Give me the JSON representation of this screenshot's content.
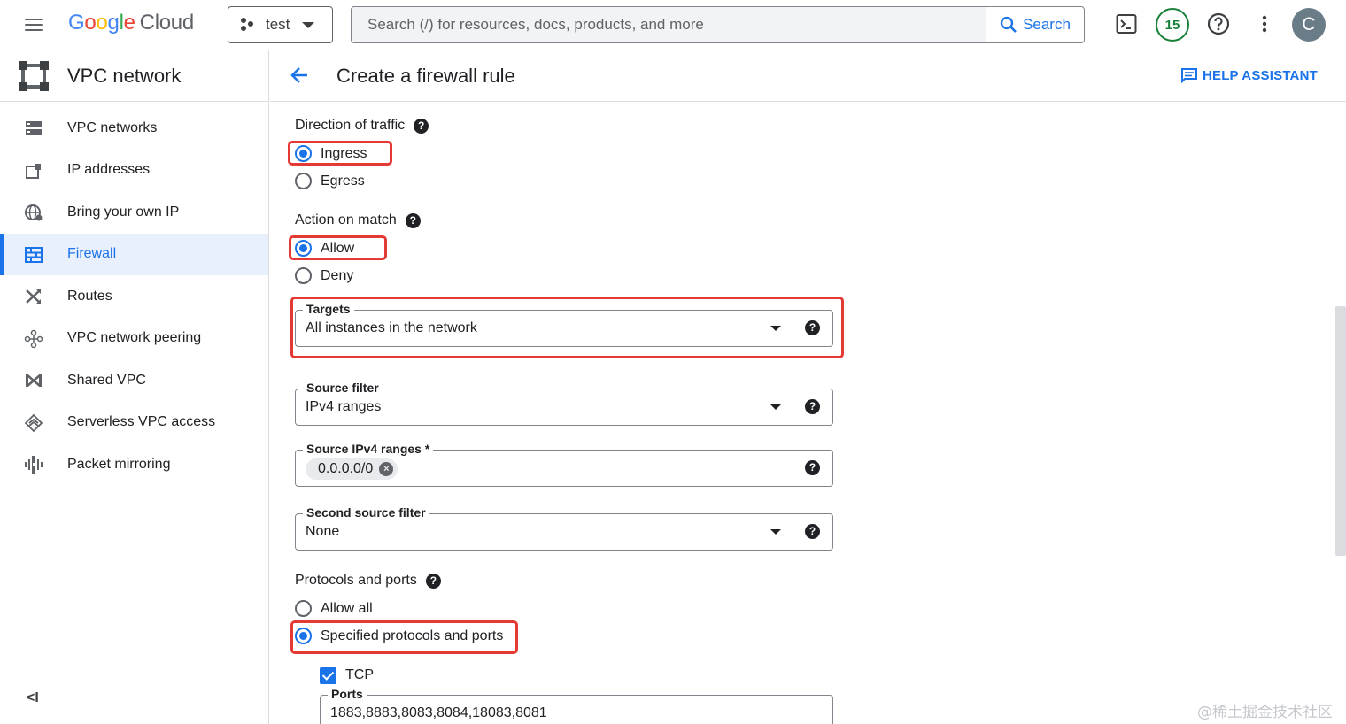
{
  "topbar": {
    "logo_google": [
      "G",
      "o",
      "o",
      "g",
      "l",
      "e"
    ],
    "logo_cloud": "Cloud",
    "project": "test",
    "search_placeholder": "Search (/) for resources, docs, products, and more",
    "search_button": "Search",
    "notifications_count": "15",
    "avatar_letter": "C"
  },
  "sidebar": {
    "title": "VPC network",
    "items": [
      {
        "label": "VPC networks",
        "icon": "vpc-networks-icon"
      },
      {
        "label": "IP addresses",
        "icon": "ip-addresses-icon"
      },
      {
        "label": "Bring your own IP",
        "icon": "globe-icon"
      },
      {
        "label": "Firewall",
        "icon": "firewall-icon",
        "active": true
      },
      {
        "label": "Routes",
        "icon": "routes-icon"
      },
      {
        "label": "VPC network peering",
        "icon": "peering-icon"
      },
      {
        "label": "Shared VPC",
        "icon": "shared-vpc-icon"
      },
      {
        "label": "Serverless VPC access",
        "icon": "serverless-icon"
      },
      {
        "label": "Packet mirroring",
        "icon": "packet-mirroring-icon"
      }
    ],
    "collapse": "<I"
  },
  "header": {
    "title": "Create a firewall rule",
    "help_assistant": "HELP ASSISTANT"
  },
  "form": {
    "direction": {
      "label": "Direction of traffic",
      "options": [
        "Ingress",
        "Egress"
      ],
      "selected": "Ingress"
    },
    "action": {
      "label": "Action on match",
      "options": [
        "Allow",
        "Deny"
      ],
      "selected": "Allow"
    },
    "targets": {
      "label": "Targets",
      "value": "All instances in the network"
    },
    "source_filter": {
      "label": "Source filter",
      "value": "IPv4 ranges"
    },
    "source_ranges": {
      "label": "Source IPv4 ranges *",
      "chip": "0.0.0.0/0"
    },
    "second_source_filter": {
      "label": "Second source filter",
      "value": "None"
    },
    "protocols": {
      "label": "Protocols and ports",
      "options": [
        "Allow all",
        "Specified protocols and ports"
      ],
      "selected": "Specified protocols and ports",
      "tcp_label": "TCP",
      "tcp_checked": true,
      "ports_label": "Ports",
      "ports_value": "1883,8883,8083,8084,18083,8081"
    }
  },
  "watermark": "@稀土掘金技术社区",
  "colors": {
    "accent": "#1a73e8",
    "highlight": "#e53935",
    "badge": "#188038"
  }
}
